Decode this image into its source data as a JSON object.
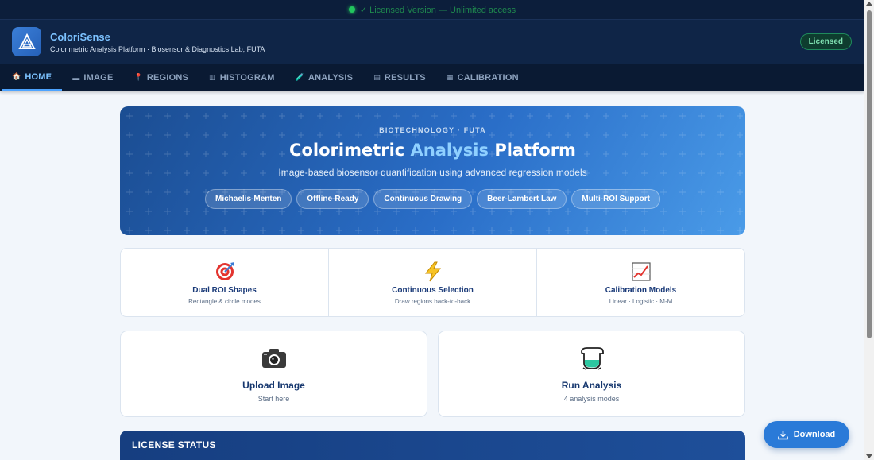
{
  "topbar": {
    "text": "✓ Licensed Version — Unlimited access"
  },
  "header": {
    "app_name": "ColoriSense",
    "subtitle": "Colorimetric Analysis Platform · Biosensor & Diagnostics Lab, FUTA",
    "license_badge": "Licensed"
  },
  "nav": {
    "tabs": [
      {
        "label": "HOME",
        "icon": "home-icon",
        "glyph": "🏠"
      },
      {
        "label": "IMAGE",
        "icon": "image-icon",
        "glyph": "▬"
      },
      {
        "label": "REGIONS",
        "icon": "regions-icon",
        "glyph": "📍"
      },
      {
        "label": "HISTOGRAM",
        "icon": "histogram-icon",
        "glyph": "▥"
      },
      {
        "label": "ANALYSIS",
        "icon": "analysis-icon",
        "glyph": "🧪"
      },
      {
        "label": "RESULTS",
        "icon": "results-icon",
        "glyph": "▤"
      },
      {
        "label": "CALIBRATION",
        "icon": "calibration-icon",
        "glyph": "▦"
      }
    ],
    "active": "HOME"
  },
  "hero": {
    "kicker": "BIOTECHNOLOGY · FUTA",
    "title_pre": "Colorimetric ",
    "title_hl": "Analysis",
    "title_post": " Platform",
    "subtitle": "Image-based biosensor quantification using advanced regression models",
    "chips": [
      "Michaelis-Menten",
      "Offline-Ready",
      "Continuous Drawing",
      "Beer-Lambert Law",
      "Multi-ROI Support"
    ]
  },
  "features": [
    {
      "title": "Dual ROI Shapes",
      "desc": "Rectangle & circle modes",
      "icon": "target-icon"
    },
    {
      "title": "Continuous Selection",
      "desc": "Draw regions back-to-back",
      "icon": "lightning-icon"
    },
    {
      "title": "Calibration Models",
      "desc": "Linear · Logistic · M-M",
      "icon": "chart-icon"
    }
  ],
  "actions": [
    {
      "title": "Upload Image",
      "desc": "Start here",
      "icon": "camera-icon"
    },
    {
      "title": "Run Analysis",
      "desc": "4 analysis modes",
      "icon": "flask-icon"
    }
  ],
  "license_section": {
    "heading": "LICENSE STATUS"
  },
  "download": {
    "label": "Download",
    "icon": "download-icon"
  },
  "colors": {
    "navy": "#0f2547",
    "accent": "#4da3ff",
    "hero_start": "#1b4d92",
    "hero_end": "#4a9be8",
    "success": "#22c55e",
    "button": "#2a7ad8"
  }
}
